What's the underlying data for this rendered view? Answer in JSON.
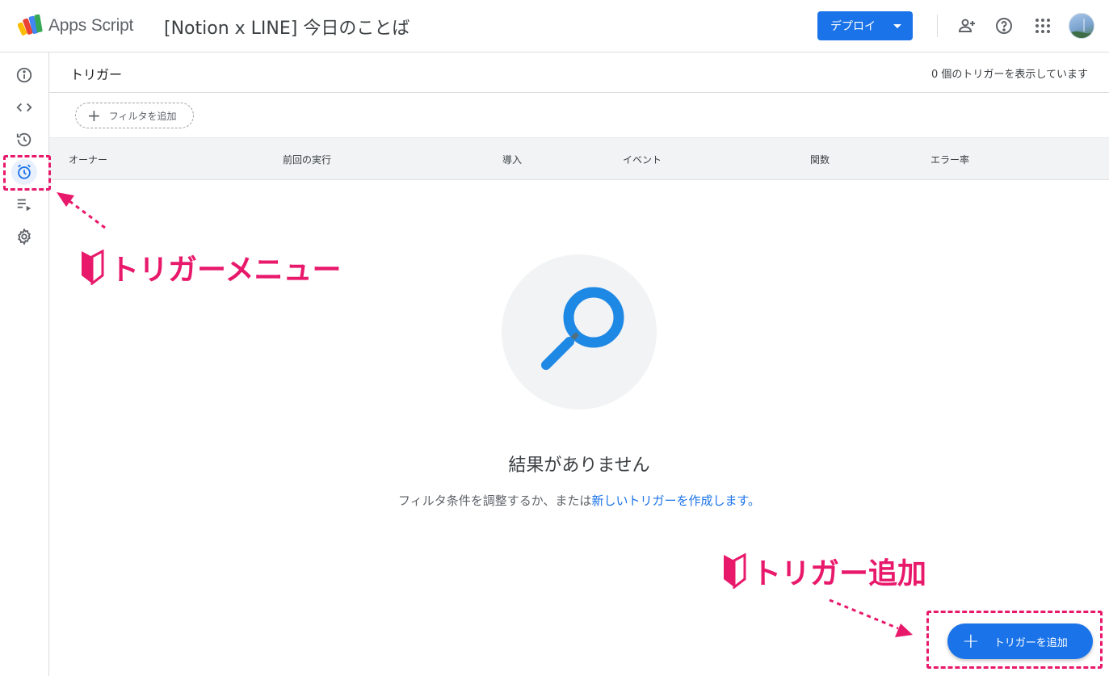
{
  "topbar": {
    "app_name": "Apps Script",
    "project_title": "[Notion x LINE] 今日のことば",
    "deploy_label": "デプロイ",
    "icons": [
      "add-person-icon",
      "help-icon",
      "apps-grid-icon"
    ]
  },
  "sidebar": {
    "items": [
      {
        "name": "overview",
        "icon": "info-icon"
      },
      {
        "name": "editor",
        "icon": "code-icon"
      },
      {
        "name": "history",
        "icon": "history-icon"
      },
      {
        "name": "triggers",
        "icon": "alarm-clock-icon",
        "active": true
      },
      {
        "name": "executions",
        "icon": "playlist-play-icon"
      },
      {
        "name": "settings",
        "icon": "gear-icon"
      }
    ]
  },
  "main": {
    "title": "トリガー",
    "count_text": "0 個のトリガーを表示しています",
    "filter_label": "フィルタを追加",
    "columns": [
      "オーナー",
      "前回の実行",
      "導入",
      "イベント",
      "関数",
      "エラー率"
    ],
    "empty_title": "結果がありません",
    "empty_sub_prefix": "フィルタ条件を調整するか、または",
    "empty_sub_link": "新しいトリガーを作成します。",
    "fab_label": "トリガーを追加"
  },
  "annotations": {
    "menu_label": "トリガーメニュー",
    "add_label": "トリガー追加"
  },
  "colors": {
    "accent": "#1a73e8",
    "annotation": "#e8196b",
    "search_icon": "#1e88e5"
  }
}
